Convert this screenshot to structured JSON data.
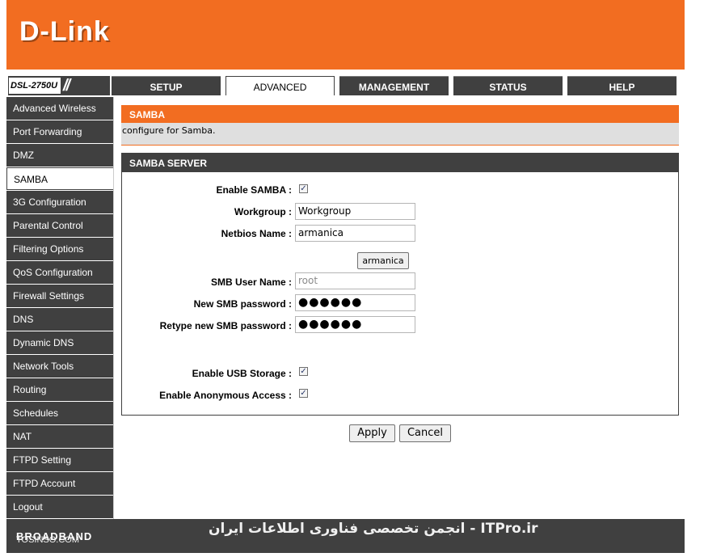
{
  "header": {
    "logo": "D-Link"
  },
  "model": {
    "label": "DSL-2750U",
    "slashes": "//"
  },
  "tabs": [
    {
      "label": "SETUP"
    },
    {
      "label": "ADVANCED"
    },
    {
      "label": "MANAGEMENT"
    },
    {
      "label": "STATUS"
    },
    {
      "label": "HELP"
    }
  ],
  "active_tab": "ADVANCED",
  "sidebar": {
    "items": [
      {
        "label": "Advanced Wireless"
      },
      {
        "label": "Port Forwarding"
      },
      {
        "label": "DMZ"
      },
      {
        "label": "SAMBA"
      },
      {
        "label": "3G Configuration"
      },
      {
        "label": "Parental Control"
      },
      {
        "label": "Filtering Options"
      },
      {
        "label": "QoS Configuration"
      },
      {
        "label": "Firewall Settings"
      },
      {
        "label": "DNS"
      },
      {
        "label": "Dynamic DNS"
      },
      {
        "label": "Network Tools"
      },
      {
        "label": "Routing"
      },
      {
        "label": "Schedules"
      },
      {
        "label": "NAT"
      },
      {
        "label": "FTPD Setting"
      },
      {
        "label": "FTPD Account"
      },
      {
        "label": "Logout"
      }
    ],
    "active": "SAMBA"
  },
  "section": {
    "title": "SAMBA",
    "description": "configure for Samba."
  },
  "server": {
    "title": "SAMBA SERVER",
    "enable_samba_label": "Enable SAMBA :",
    "enable_samba_checked": true,
    "workgroup_label": "Workgroup :",
    "workgroup_value": "Workgroup",
    "netbios_label": "Netbios Name :",
    "netbios_value": "armanica",
    "netbios_button": "armanica",
    "smb_user_label": "SMB User Name :",
    "smb_user_value": "root",
    "new_pw_label": "New SMB password :",
    "new_pw_value": "●●●●●●",
    "retype_pw_label": "Retype new SMB password :",
    "retype_pw_value": "●●●●●●",
    "usb_label": "Enable USB Storage :",
    "usb_checked": true,
    "anon_label": "Enable Anonymous Access :",
    "anon_checked": true
  },
  "actions": {
    "apply": "Apply",
    "cancel": "Cancel"
  },
  "footer": {
    "brand": "BROADBAND",
    "watermark": "انجمن تخصصی فناوری اطلاعات ایران - ITPro.ir",
    "watermark_site": "TOSINSO.COM"
  },
  "colors": {
    "accent": "#f26d21",
    "dark": "#404040",
    "light_panel": "#dfdfdf"
  }
}
